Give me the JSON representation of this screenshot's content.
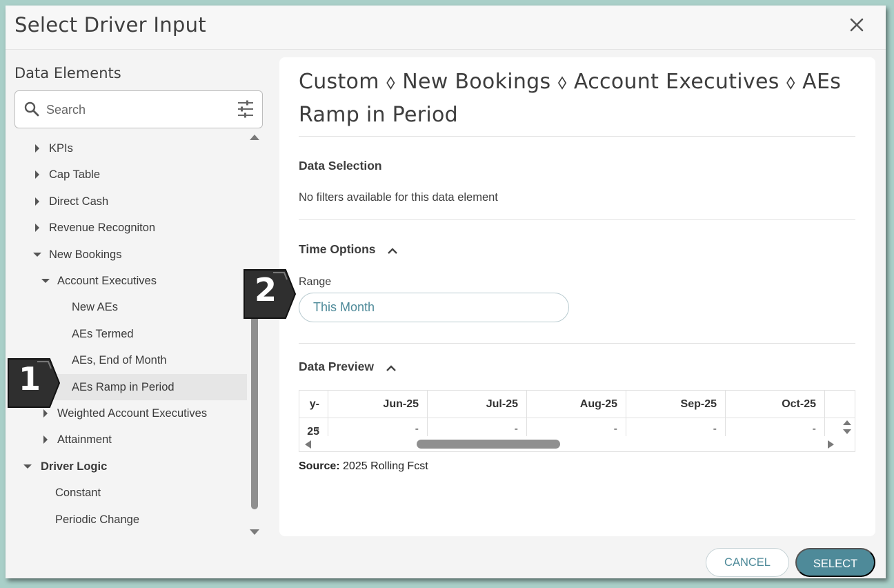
{
  "dialog": {
    "title": "Select Driver Input",
    "close_icon": "close-icon"
  },
  "left": {
    "title": "Data Elements",
    "search_placeholder": "Search",
    "tree": [
      {
        "label": "KPIs",
        "indent": 1,
        "caret": "right"
      },
      {
        "label": "Cap Table",
        "indent": 1,
        "caret": "right"
      },
      {
        "label": "Direct Cash",
        "indent": 1,
        "caret": "right"
      },
      {
        "label": "Revenue Recogniton",
        "indent": 1,
        "caret": "right"
      },
      {
        "label": "New Bookings",
        "indent": 1,
        "caret": "down"
      },
      {
        "label": "Account Executives",
        "indent": 2,
        "caret": "down"
      },
      {
        "label": "New AEs",
        "indent": 3,
        "caret": ""
      },
      {
        "label": "AEs Termed",
        "indent": 3,
        "caret": ""
      },
      {
        "label": "AEs, End of Month",
        "indent": 3,
        "caret": ""
      },
      {
        "label": "AEs Ramp in Period",
        "indent": 3,
        "caret": "",
        "selected": true
      },
      {
        "label": "Weighted Account Executives",
        "indent": 2,
        "caret": "right"
      },
      {
        "label": "Attainment",
        "indent": 2,
        "caret": "right"
      },
      {
        "label": "Driver Logic",
        "indent": 0,
        "caret": "down",
        "bold": true
      },
      {
        "label": "Constant",
        "indent": 0.5,
        "caret": ""
      },
      {
        "label": "Periodic Change",
        "indent": 0.5,
        "caret": ""
      }
    ]
  },
  "right": {
    "breadcrumb": "Custom ⬨ New Bookings ⬨ Account Executives ⬨ AEs Ramp in Period",
    "data_selection": {
      "title": "Data Selection",
      "message": "No filters available for this data element"
    },
    "time_options": {
      "title": "Time Options",
      "range_label": "Range",
      "range_value": "This Month"
    },
    "data_preview": {
      "title": "Data Preview",
      "columns": [
        "y-25",
        "Jun-25",
        "Jul-25",
        "Aug-25",
        "Sep-25",
        "Oct-25",
        ""
      ],
      "values": [
        "-",
        "-",
        "-",
        "-",
        "-",
        "-",
        ""
      ],
      "source_label": "Source:",
      "source_value": "2025 Rolling Fcst"
    }
  },
  "footer": {
    "cancel_label": "CANCEL",
    "select_label": "SELECT"
  },
  "callouts": [
    "1",
    "2"
  ],
  "colors": {
    "accent": "#4e8a99",
    "backdrop": "#a9cfc8",
    "badge": "#2f2f2f"
  }
}
